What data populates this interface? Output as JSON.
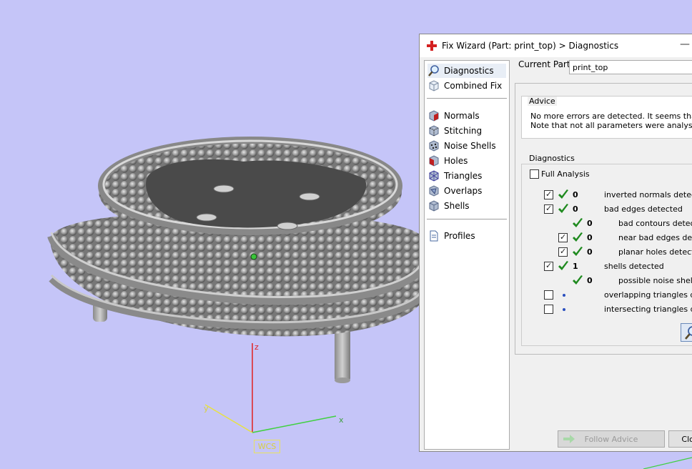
{
  "viewport": {
    "background": "#c5c5f8",
    "axis_labels": {
      "x": "x",
      "y": "y",
      "z": "z"
    },
    "wcs_label": "WCS",
    "axis_colors": {
      "x": "#40d040",
      "y": "#e8e240",
      "z": "#e02020"
    }
  },
  "dialog": {
    "title": "Fix Wizard (Part: print_top) > Diagnostics",
    "close_icon": "close-icon",
    "nav": {
      "top": [
        {
          "label": "Diagnostics",
          "icon": "magnifier-icon"
        },
        {
          "label": "Combined Fix",
          "icon": "cube-outline-icon"
        }
      ],
      "tools": [
        {
          "label": "Normals",
          "icon": "normals-cube-icon"
        },
        {
          "label": "Stitching",
          "icon": "stitching-cube-icon"
        },
        {
          "label": "Noise Shells",
          "icon": "noise-shells-icon"
        },
        {
          "label": "Holes",
          "icon": "holes-cube-icon"
        },
        {
          "label": "Triangles",
          "icon": "triangles-cube-icon"
        },
        {
          "label": "Overlaps",
          "icon": "overlaps-cube-icon"
        },
        {
          "label": "Shells",
          "icon": "shells-cube-icon"
        }
      ],
      "bottom": [
        {
          "label": "Profiles",
          "icon": "document-icon"
        }
      ]
    },
    "current_part_label": "Current Part:",
    "current_part_value": "print_top",
    "advice": {
      "legend": "Advice",
      "line1": "No more errors are detected. It seems that the",
      "line2": "Note that not all parameters were analysed."
    },
    "diagnostics": {
      "legend": "Diagnostics",
      "full_analysis_label": "Full Analysis",
      "rows": [
        {
          "checked": true,
          "status": "ok",
          "count": "0",
          "label": "inverted normals detected"
        },
        {
          "checked": true,
          "status": "ok",
          "count": "0",
          "label": "bad edges detected"
        },
        {
          "checked": null,
          "status": "ok",
          "count": "0",
          "label": "bad contours detecte"
        },
        {
          "checked": true,
          "status": "ok",
          "count": "0",
          "label": "near bad edges detec"
        },
        {
          "checked": true,
          "status": "ok",
          "count": "0",
          "label": "planar holes detected"
        },
        {
          "checked": true,
          "status": "ok",
          "count": "1",
          "label": "shells detected"
        },
        {
          "checked": null,
          "status": "ok",
          "count": "0",
          "label": "possible noise shells d"
        },
        {
          "checked": false,
          "status": "pending",
          "count": "",
          "label": "overlapping triangles dete"
        },
        {
          "checked": false,
          "status": "pending",
          "count": "",
          "label": "intersecting triangles dete"
        }
      ]
    },
    "buttons": {
      "follow_advice": "Follow Advice",
      "close": "Clos"
    }
  }
}
